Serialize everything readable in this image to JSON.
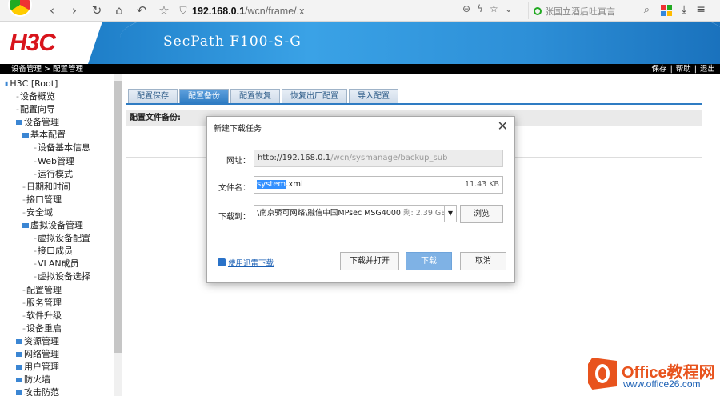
{
  "browser": {
    "address_host": "192.168.0.1",
    "address_path": "/wcn/frame/.x",
    "search_placeholder": "张国立酒后吐真言",
    "nav_icons": [
      "back-icon",
      "forward-icon",
      "refresh-icon",
      "home-icon",
      "undo-icon",
      "star-icon"
    ]
  },
  "header": {
    "logo": "H3C",
    "product": "SecPath F100-S-G"
  },
  "status_bar": {
    "breadcrumb": "设备管理 > 配置管理",
    "links": [
      "保存",
      "|",
      "帮助",
      "|",
      "退出"
    ]
  },
  "sidebar": {
    "items": [
      {
        "label": "H3C [Root]",
        "level": 0,
        "folder": false
      },
      {
        "label": "设备概览",
        "level": 1,
        "folder": false
      },
      {
        "label": "配置向导",
        "level": 1,
        "folder": false
      },
      {
        "label": "设备管理",
        "level": 1,
        "folder": true
      },
      {
        "label": "基本配置",
        "level": 2,
        "folder": true
      },
      {
        "label": "设备基本信息",
        "level": 3,
        "folder": false
      },
      {
        "label": "Web管理",
        "level": 3,
        "folder": false
      },
      {
        "label": "运行模式",
        "level": 3,
        "folder": false
      },
      {
        "label": "日期和时间",
        "level": 2,
        "folder": false
      },
      {
        "label": "接口管理",
        "level": 2,
        "folder": false
      },
      {
        "label": "安全域",
        "level": 2,
        "folder": false
      },
      {
        "label": "虚拟设备管理",
        "level": 2,
        "folder": true
      },
      {
        "label": "虚拟设备配置",
        "level": 3,
        "folder": false
      },
      {
        "label": "接口成员",
        "level": 3,
        "folder": false
      },
      {
        "label": "VLAN成员",
        "level": 3,
        "folder": false
      },
      {
        "label": "虚拟设备选择",
        "level": 3,
        "folder": false
      },
      {
        "label": "配置管理",
        "level": 2,
        "folder": false
      },
      {
        "label": "服务管理",
        "level": 2,
        "folder": false
      },
      {
        "label": "软件升级",
        "level": 2,
        "folder": false
      },
      {
        "label": "设备重启",
        "level": 2,
        "folder": false
      },
      {
        "label": "资源管理",
        "level": 1,
        "folder": true
      },
      {
        "label": "网络管理",
        "level": 1,
        "folder": true
      },
      {
        "label": "用户管理",
        "level": 1,
        "folder": true
      },
      {
        "label": "防火墙",
        "level": 1,
        "folder": true
      },
      {
        "label": "攻击防范",
        "level": 1,
        "folder": true
      }
    ]
  },
  "tabs": [
    {
      "label": "配置保存",
      "active": false
    },
    {
      "label": "配置备份",
      "active": true
    },
    {
      "label": "配置恢复",
      "active": false
    },
    {
      "label": "恢复出厂配置",
      "active": false
    },
    {
      "label": "导入配置",
      "active": false
    }
  ],
  "content": {
    "section_title": "配置文件备份:"
  },
  "dialog": {
    "title": "新建下载任务",
    "url_label": "网址：",
    "url_host": "http://192.168.0.1",
    "url_path": "/wcn/sysmanage/backup_sub",
    "file_label": "文件名：",
    "file_selected": "system",
    "file_ext": ".xml",
    "file_size": "11.43 KB",
    "dl_label": "下载到：",
    "dl_path": "\\南京骄可网络\\融信中国MPsec MSG4000",
    "dl_free": "剩: 2.39 GB",
    "browse": "浏览",
    "thunder": "使用迅雷下载",
    "open_button": "下载并打开",
    "download_button": "下载",
    "cancel_button": "取消"
  },
  "watermark": {
    "line1": "Office教程网",
    "line2": "www.office26.com"
  }
}
